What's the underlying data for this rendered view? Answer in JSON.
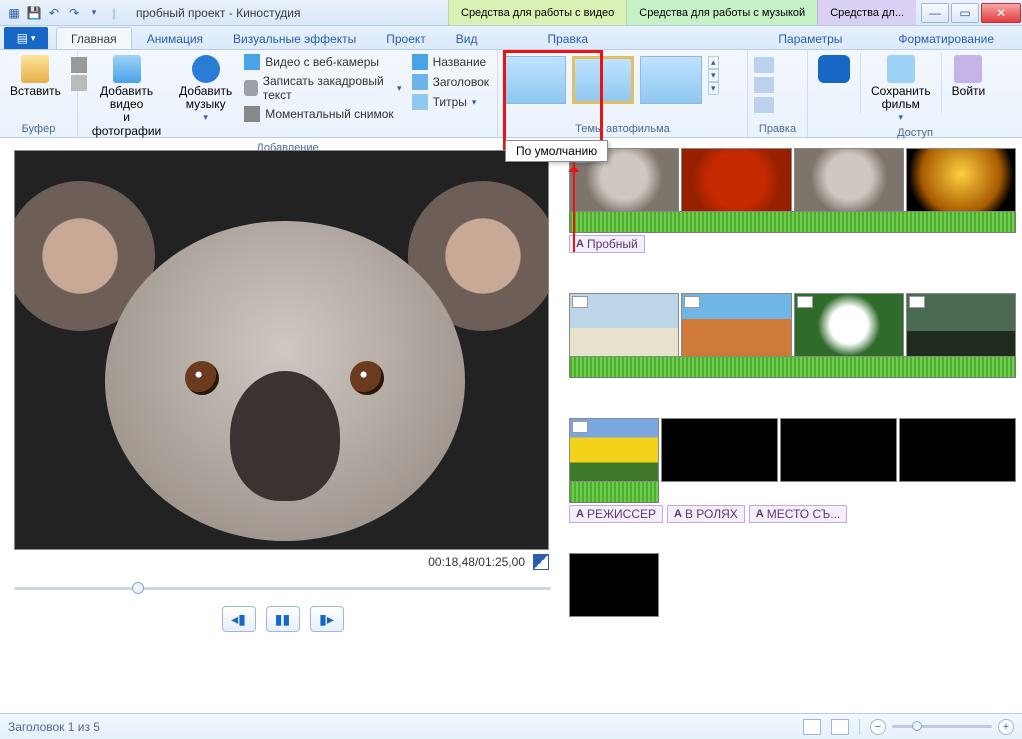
{
  "title": "пробный проект - Киностудия",
  "context_tabs": {
    "video": "Средства для работы с видео",
    "music": "Средства для работы с музыкой",
    "text": "Средства дл..."
  },
  "tabs": {
    "home": "Главная",
    "animation": "Анимация",
    "effects": "Визуальные эффекты",
    "project": "Проект",
    "view": "Вид",
    "edit": "Правка",
    "params": "Параметры",
    "format": "Форматирование"
  },
  "ribbon": {
    "buffer": {
      "label": "Буфер",
      "paste": "Вставить"
    },
    "add": {
      "label": "Добавление",
      "photos": "Добавить видео\nи фотографии",
      "music": "Добавить\nмузыку",
      "webcam": "Видео с веб-камеры",
      "voice": "Записать закадровый текст",
      "snapshot": "Моментальный снимок",
      "title": "Название",
      "caption": "Заголовок",
      "credits": "Титры"
    },
    "themes": {
      "label": "Темы автофильма",
      "tooltip": "По умолчанию"
    },
    "editgrp": {
      "label": "Правка"
    },
    "access": {
      "label": "Доступ",
      "save": "Сохранить\nфильм",
      "signin": "Войти"
    }
  },
  "preview": {
    "time": "00:18,48/01:25,00"
  },
  "timeline": {
    "tag1": "Пробный",
    "tags2": [
      "РЕЖИССЕР",
      "В РОЛЯХ",
      "МЕСТО СЪ..."
    ]
  },
  "status": {
    "caption": "Заголовок 1 из 5"
  }
}
